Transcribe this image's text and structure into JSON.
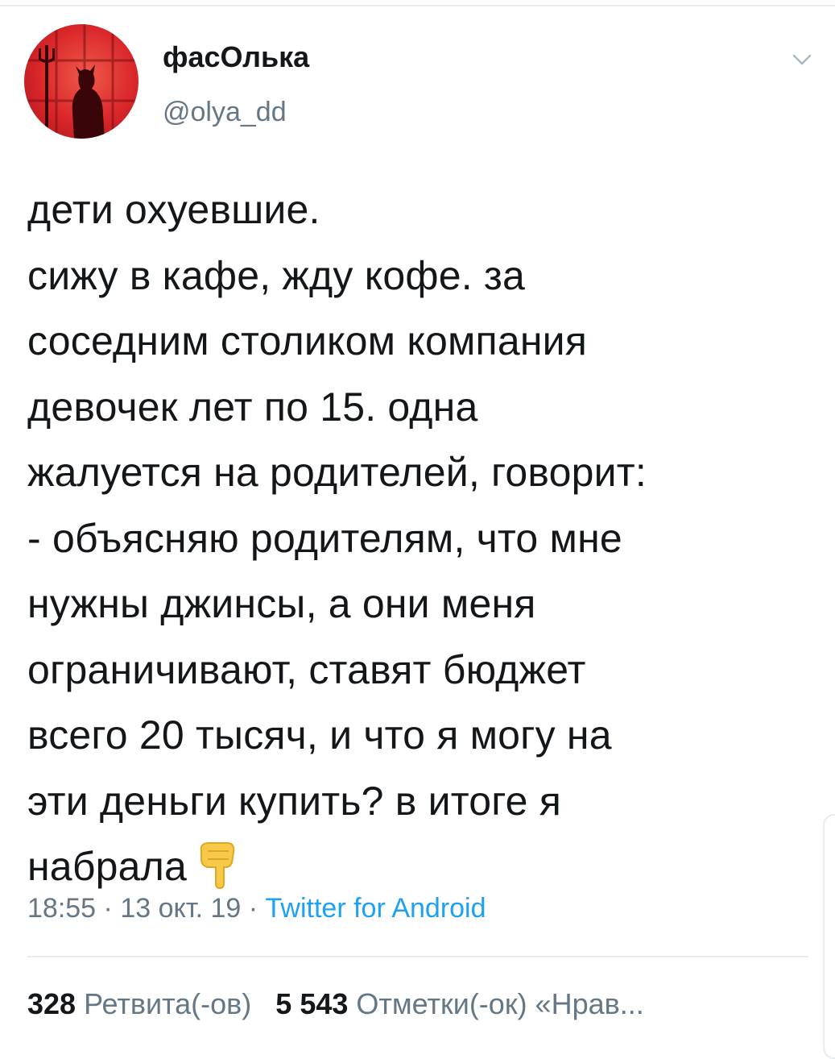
{
  "tweet": {
    "author": {
      "display_name": "фасОлька",
      "handle": "@olya_dd"
    },
    "text_lines": [
      "дети охуевшие.",
      "сижу в кафе, жду кофе. за",
      "соседним столиком компания",
      "девочек лет по 15. одна",
      "жалуется на родителей, говорит:",
      "- объясняю родителям, что мне",
      "нужны джинсы, а они меня",
      "ограничивают, ставят бюджет",
      "всего 20 тысяч, и что я могу на",
      "эти деньги купить? в итоге я",
      "набрала"
    ],
    "emoji": "pointing-down-emoji",
    "time": "18:55",
    "date": "13 окт. 19",
    "separator": "·",
    "source": "Twitter for Android",
    "retweets_count": "328",
    "retweets_label": "Ретвита(-ов)",
    "likes_count": "5 543",
    "likes_label": "Отметки(-ок) «Нрав..."
  },
  "colors": {
    "text": "#14171a",
    "secondary": "#657786",
    "link": "#1da1f2",
    "avatar": "#d9262a",
    "emoji": "#f7c948"
  },
  "icons": {
    "menu": "chevron-down-icon"
  }
}
